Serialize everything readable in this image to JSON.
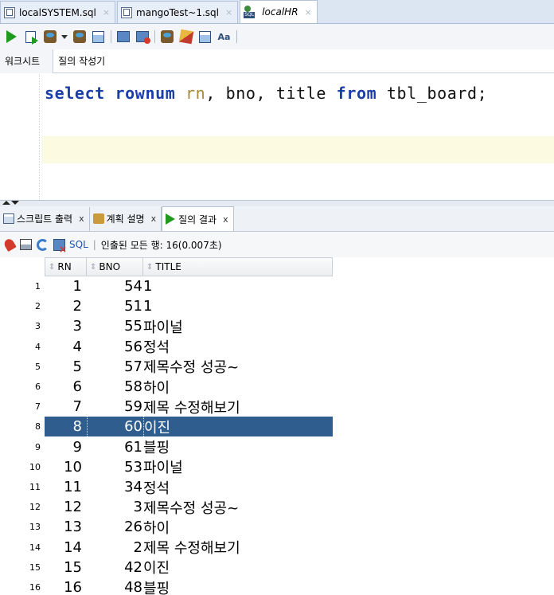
{
  "doc_tabs": [
    {
      "label": "localSYSTEM.sql",
      "close": "×",
      "active": false
    },
    {
      "label": "mangoTest~1.sql",
      "close": "×",
      "active": false
    },
    {
      "label": "localHR",
      "close": "×",
      "active": true
    }
  ],
  "toolbar": {
    "icons": [
      "run-statement-icon",
      "run-script-icon",
      "commit-icon",
      "dropdown-caret-icon",
      "rollback-icon",
      "explain-plan-icon",
      "autotrace-icon",
      "sql-tuning-icon",
      "sql-history-icon",
      "clear-icon",
      "format-icon",
      "uppercase-icon"
    ]
  },
  "worksheet_tabs": {
    "worksheet": "워크시트",
    "query_builder": "질의 작성기"
  },
  "editor": {
    "code": {
      "kw_select": "select",
      "kw_rownum": "rownum",
      "alias_rn": "rn",
      "sep1": ", bno, title ",
      "kw_from": "from",
      "rest": " tbl_board;"
    }
  },
  "result_tabs": [
    {
      "label": "스크립트 출력",
      "close": "x",
      "active": false
    },
    {
      "label": "계획 설명",
      "close": "x",
      "active": false
    },
    {
      "label": "질의 결과",
      "close": "x",
      "active": true
    }
  ],
  "result_toolbar": {
    "sql_label": "SQL",
    "separator": "|",
    "status": "인출된 모든 행: 16(0.007초)"
  },
  "grid": {
    "columns": [
      "RN",
      "BNO",
      "TITLE"
    ],
    "selected_row": 8,
    "rows": [
      {
        "num": "1",
        "rn": "1",
        "bno": "54",
        "title": "1"
      },
      {
        "num": "2",
        "rn": "2",
        "bno": "51",
        "title": "1"
      },
      {
        "num": "3",
        "rn": "3",
        "bno": "55",
        "title": "파이널"
      },
      {
        "num": "4",
        "rn": "4",
        "bno": "56",
        "title": "정석"
      },
      {
        "num": "5",
        "rn": "5",
        "bno": "57",
        "title": "제목수정 성공~"
      },
      {
        "num": "6",
        "rn": "6",
        "bno": "58",
        "title": "하이"
      },
      {
        "num": "7",
        "rn": "7",
        "bno": "59",
        "title": "제목 수정해보기"
      },
      {
        "num": "8",
        "rn": "8",
        "bno": "60",
        "title": "이진"
      },
      {
        "num": "9",
        "rn": "9",
        "bno": "61",
        "title": "블핑"
      },
      {
        "num": "10",
        "rn": "10",
        "bno": "53",
        "title": "파이널"
      },
      {
        "num": "11",
        "rn": "11",
        "bno": "34",
        "title": "정석"
      },
      {
        "num": "12",
        "rn": "12",
        "bno": "3",
        "title": "제목수정 성공~"
      },
      {
        "num": "13",
        "rn": "13",
        "bno": "26",
        "title": "하이"
      },
      {
        "num": "14",
        "rn": "14",
        "bno": "2",
        "title": "제목 수정해보기"
      },
      {
        "num": "15",
        "rn": "15",
        "bno": "42",
        "title": "이진"
      },
      {
        "num": "16",
        "rn": "16",
        "bno": "48",
        "title": "블핑"
      }
    ]
  },
  "colors": {
    "keyword": "#1b3ea8",
    "alias": "#a58a3c",
    "selection": "#2e5d8e",
    "current_line": "#fcfbe2"
  }
}
